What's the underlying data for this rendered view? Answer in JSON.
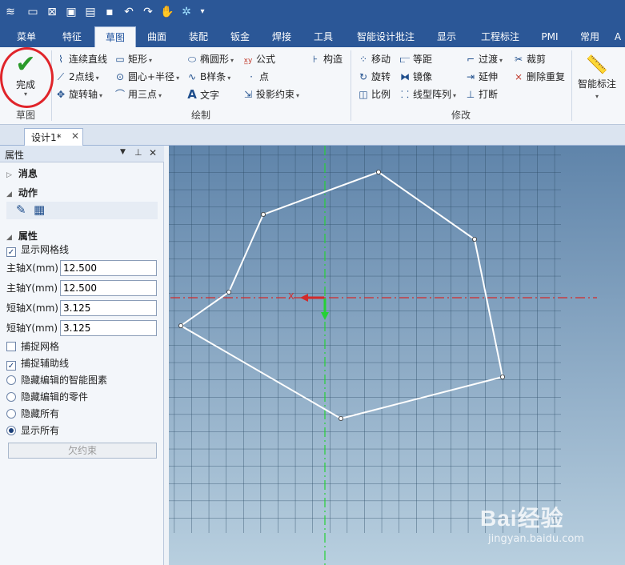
{
  "quick_access": {
    "icons": [
      "app-menu-icon",
      "new-file-icon",
      "save-close-icon",
      "open-icon",
      "folder-icon",
      "save-icon",
      "undo-icon",
      "redo-icon",
      "hand-icon",
      "wizard-icon",
      "more-icon"
    ]
  },
  "ribbon_tabs": [
    "菜单",
    "特征",
    "草图",
    "曲面",
    "装配",
    "钣金",
    "焊接",
    "工具",
    "智能设计批注",
    "显示",
    "工程标注",
    "PMI",
    "常用",
    "A"
  ],
  "active_tab": "草图",
  "groups": {
    "sketch_label": "草图",
    "draw_label": "绘制",
    "modify_label": "修改"
  },
  "done_button": "完成",
  "draw_tools": {
    "polyline": "连续直线",
    "rectangle": "矩形",
    "ellipse": "椭圆形",
    "formula": "公式",
    "construct": "构造",
    "two_point": "2点线",
    "circle": "圆心+半径",
    "bspline": "B样条",
    "point": "点",
    "rotate_axis": "旋转轴",
    "three_point": "用三点",
    "text": "文字",
    "project": "投影约束"
  },
  "modify_tools": {
    "move": "移动",
    "offset": "等距",
    "transition": "过渡",
    "trim": "裁剪",
    "rotate": "旋转",
    "mirror": "镜像",
    "extend": "延伸",
    "delete_dup": "删除重复",
    "scale": "比例",
    "linear_array": "线型阵列",
    "break": "打断"
  },
  "smart_dim": "智能标注",
  "doc_tab": "设计1*",
  "panel": {
    "title": "属性",
    "section_message": "消息",
    "section_action": "动作",
    "section_props": "属性",
    "show_grid": "显示网格线",
    "major_x_label": "主轴X(mm)",
    "major_x_value": "12.500",
    "major_y_label": "主轴Y(mm)",
    "major_y_value": "12.500",
    "minor_x_label": "短轴X(mm)",
    "minor_x_value": "3.125",
    "minor_y_label": "短轴Y(mm)",
    "minor_y_value": "3.125",
    "snap_grid": "捕捉网格",
    "snap_guide": "捕捉辅助线",
    "hide_smart": "隐藏编辑的智能图素",
    "hide_parts": "隐藏编辑的零件",
    "hide_all": "隐藏所有",
    "show_all": "显示所有",
    "under_constraint": "欠约束"
  },
  "axis_label": "X",
  "watermark": {
    "brand": "Bai经验",
    "url": "jingyan.baidu.com"
  },
  "colors": {
    "titlebar": "#2b5797",
    "accent_red": "#e0242a",
    "check_green": "#2a9a2a",
    "axis_green": "#1ecb2d",
    "axis_red": "#e0242a"
  }
}
